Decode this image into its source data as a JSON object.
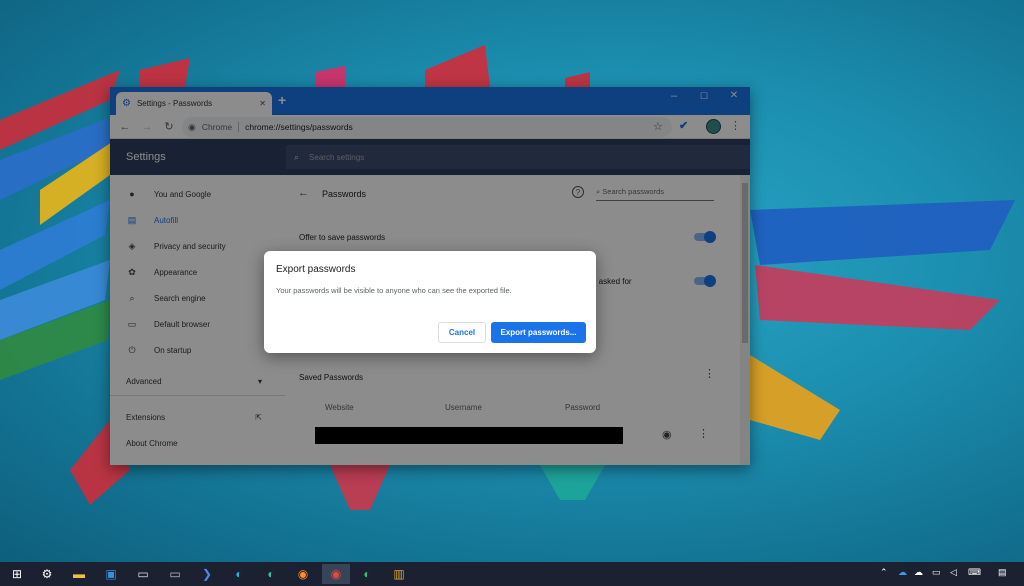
{
  "browser": {
    "tab_title": "Settings - Passwords",
    "new_tab": "+",
    "controls": {
      "minimize": "–",
      "maximize": "☐",
      "close": "✕"
    },
    "site_label": "Chrome",
    "url": "chrome://settings/passwords"
  },
  "settings": {
    "header_title": "Settings",
    "search_placeholder": "Search settings",
    "sidebar": {
      "items": [
        {
          "label": "You and Google",
          "icon": "person-icon"
        },
        {
          "label": "Autofill",
          "icon": "clipboard-icon"
        },
        {
          "label": "Privacy and security",
          "icon": "shield-icon"
        },
        {
          "label": "Appearance",
          "icon": "palette-icon"
        },
        {
          "label": "Search engine",
          "icon": "search-icon"
        },
        {
          "label": "Default browser",
          "icon": "browser-icon"
        },
        {
          "label": "On startup",
          "icon": "power-icon"
        }
      ],
      "advanced": "Advanced",
      "extensions": "Extensions",
      "about": "About Chrome"
    },
    "main": {
      "page_title": "Passwords",
      "search_passwords": "Search passwords",
      "offer_to_save": "Offer to save passwords",
      "auto_signin_tail": "e asked for",
      "saved_passwords": "Saved Passwords",
      "columns": [
        "Website",
        "Username",
        "Password"
      ]
    }
  },
  "dialog": {
    "title": "Export passwords",
    "body": "Your passwords will be visible to anyone who can see the exported file.",
    "cancel": "Cancel",
    "export": "Export passwords..."
  },
  "colors": {
    "accent": "#1a73e8",
    "header": "#2e3d60",
    "taskbar": "#1b2130"
  }
}
